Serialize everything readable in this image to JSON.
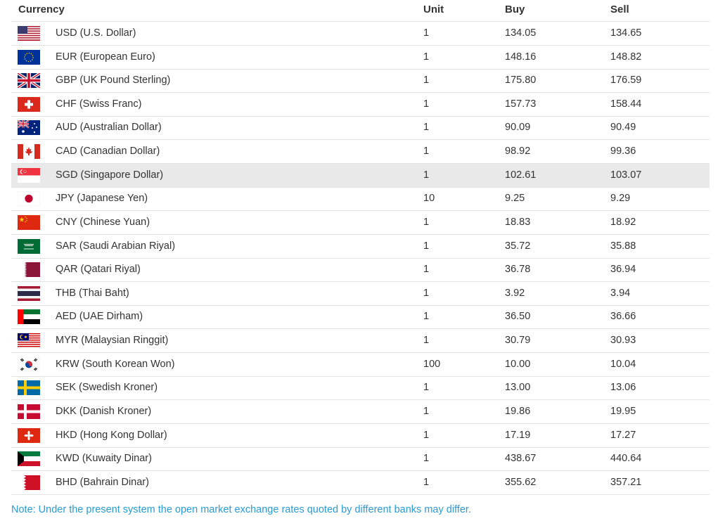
{
  "headers": {
    "currency": "Currency",
    "unit": "Unit",
    "buy": "Buy",
    "sell": "Sell"
  },
  "rows": [
    {
      "flag": "us-flag-icon",
      "name": "USD (U.S. Dollar)",
      "unit": "1",
      "buy": "134.05",
      "sell": "134.65"
    },
    {
      "flag": "eu-flag-icon",
      "name": "EUR (European Euro)",
      "unit": "1",
      "buy": "148.16",
      "sell": "148.82"
    },
    {
      "flag": "uk-flag-icon",
      "name": "GBP (UK Pound Sterling)",
      "unit": "1",
      "buy": "175.80",
      "sell": "176.59"
    },
    {
      "flag": "swiss-flag-icon",
      "name": "CHF (Swiss Franc)",
      "unit": "1",
      "buy": "157.73",
      "sell": "158.44"
    },
    {
      "flag": "australia-flag-icon",
      "name": "AUD (Australian Dollar)",
      "unit": "1",
      "buy": "90.09",
      "sell": "90.49"
    },
    {
      "flag": "canada-flag-icon",
      "name": "CAD (Canadian Dollar)",
      "unit": "1",
      "buy": "98.92",
      "sell": "99.36"
    },
    {
      "flag": "singapore-flag-icon",
      "name": "SGD (Singapore Dollar)",
      "unit": "1",
      "buy": "102.61",
      "sell": "103.07"
    },
    {
      "flag": "japan-flag-icon",
      "name": "JPY (Japanese Yen)",
      "unit": "10",
      "buy": "9.25",
      "sell": "9.29"
    },
    {
      "flag": "china-flag-icon",
      "name": "CNY (Chinese Yuan)",
      "unit": "1",
      "buy": "18.83",
      "sell": "18.92"
    },
    {
      "flag": "saudi-flag-icon",
      "name": "SAR (Saudi Arabian Riyal)",
      "unit": "1",
      "buy": "35.72",
      "sell": "35.88"
    },
    {
      "flag": "qatar-flag-icon",
      "name": "QAR (Qatari Riyal)",
      "unit": "1",
      "buy": "36.78",
      "sell": "36.94"
    },
    {
      "flag": "thailand-flag-icon",
      "name": "THB (Thai Baht)",
      "unit": "1",
      "buy": "3.92",
      "sell": "3.94"
    },
    {
      "flag": "uae-flag-icon",
      "name": "AED (UAE Dirham)",
      "unit": "1",
      "buy": "36.50",
      "sell": "36.66"
    },
    {
      "flag": "malaysia-flag-icon",
      "name": "MYR (Malaysian Ringgit)",
      "unit": "1",
      "buy": "30.79",
      "sell": "30.93"
    },
    {
      "flag": "korea-flag-icon",
      "name": "KRW (South Korean Won)",
      "unit": "100",
      "buy": "10.00",
      "sell": "10.04"
    },
    {
      "flag": "sweden-flag-icon",
      "name": "SEK (Swedish Kroner)",
      "unit": "1",
      "buy": "13.00",
      "sell": "13.06"
    },
    {
      "flag": "denmark-flag-icon",
      "name": "DKK (Danish Kroner)",
      "unit": "1",
      "buy": "19.86",
      "sell": "19.95"
    },
    {
      "flag": "hongkong-flag-icon",
      "name": "HKD (Hong Kong Dollar)",
      "unit": "1",
      "buy": "17.19",
      "sell": "17.27"
    },
    {
      "flag": "kuwait-flag-icon",
      "name": "KWD (Kuwaity Dinar)",
      "unit": "1",
      "buy": "438.67",
      "sell": "440.64"
    },
    {
      "flag": "bahrain-flag-icon",
      "name": "BHD (Bahrain Dinar)",
      "unit": "1",
      "buy": "355.62",
      "sell": "357.21"
    }
  ],
  "note": "Note: Under the present system the open market exchange rates quoted by different banks may differ."
}
